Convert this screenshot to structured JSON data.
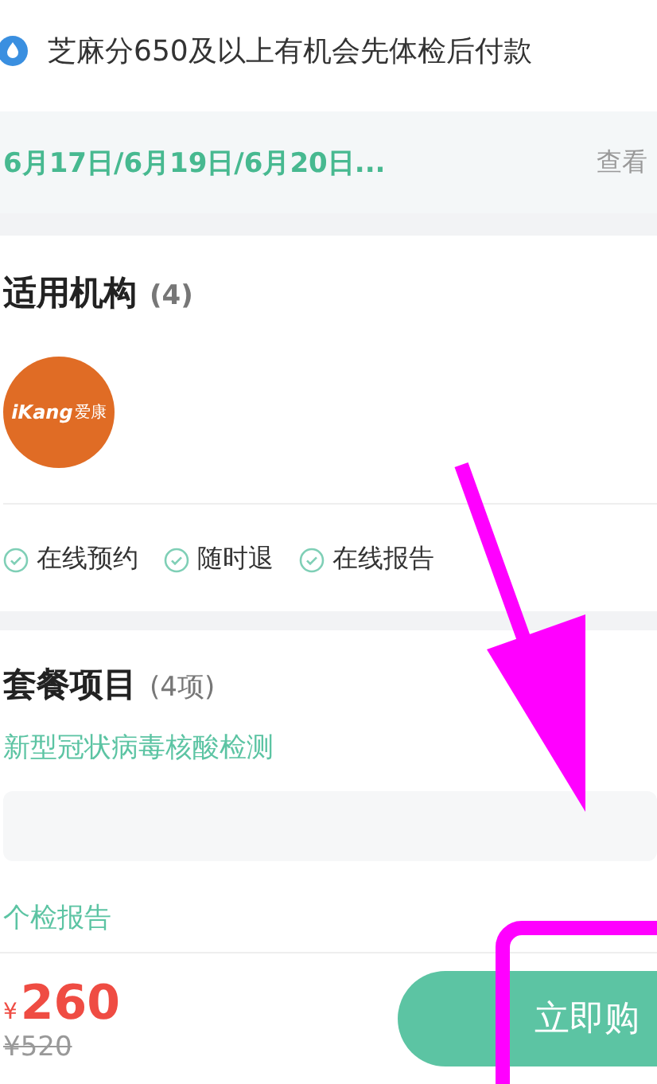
{
  "credit_notice": {
    "text": "芝麻分650及以上有机会先体检后付款"
  },
  "dates": {
    "text": "6月17日/6月19日/6月20日...",
    "link": "查看"
  },
  "institutions": {
    "title": "适用机构",
    "count": "(4)",
    "logo": {
      "brand": "iKang",
      "brand_cn": "爱康"
    },
    "features": [
      "在线预约",
      "随时退",
      "在线报告"
    ]
  },
  "package": {
    "title": "套餐项目",
    "count": "(4项)",
    "items": [
      "新型冠状病毒核酸检测"
    ],
    "report": "个检报告"
  },
  "bottom_bar": {
    "currency": "¥",
    "price": "260",
    "original_price": "¥520",
    "buy_button": "立即购"
  }
}
